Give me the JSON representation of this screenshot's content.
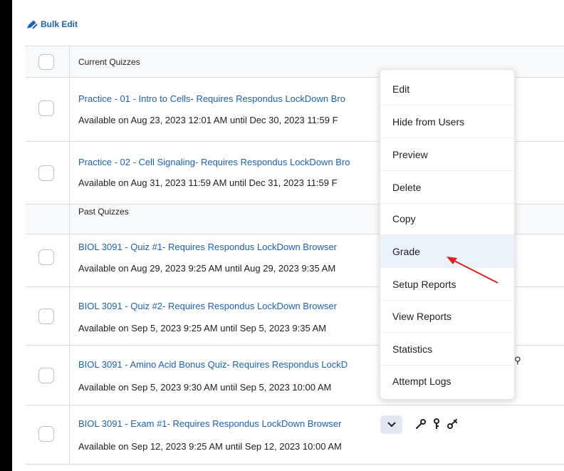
{
  "toolbar": {
    "bulk_edit_label": "Bulk Edit"
  },
  "sections": {
    "current": "Current Quizzes",
    "past": "Past Quizzes"
  },
  "quizzes": [
    {
      "title": "Practice - 01 - Intro to Cells- Requires Respondus LockDown Bro",
      "availability": "Available on Aug 23, 2023 12:01 AM until Dec 30, 2023 11:59 F"
    },
    {
      "title": "Practice - 02 - Cell Signaling- Requires Respondus LockDown Bro",
      "availability": "Available on Aug 31, 2023 11:59 AM until Dec 31, 2023 11:59 F"
    },
    {
      "title": "BIOL 3091 - Quiz #1- Requires Respondus LockDown Browser",
      "availability": "Available on Aug 29, 2023 9:25 AM until Aug 29, 2023 9:35 AM"
    },
    {
      "title": "BIOL 3091 - Quiz #2- Requires Respondus LockDown Browser",
      "availability": "Available on Sep 5, 2023 9:25 AM until Sep 5, 2023 9:35 AM"
    },
    {
      "title": "BIOL 3091 - Amino Acid Bonus Quiz- Requires Respondus LockD",
      "availability": "Available on Sep 5, 2023 9:30 AM until Sep 5, 2023 10:00 AM"
    },
    {
      "title": "BIOL 3091 - Exam #1- Requires Respondus LockDown Browser",
      "availability": "Available on Sep 12, 2023 9:25 AM until Sep 12, 2023 10:00 AM"
    }
  ],
  "context_menu": {
    "items": [
      "Edit",
      "Hide from Users",
      "Preview",
      "Delete",
      "Copy",
      "Grade",
      "Setup Reports",
      "View Reports",
      "Statistics",
      "Attempt Logs"
    ],
    "highlighted": "Grade"
  },
  "annotation": {
    "arrow_color": "#e02020"
  },
  "colors": {
    "link": "#1a63b3",
    "menu_highlight": "#eaf3fb"
  },
  "icons": [
    "bulk-edit-pencil-icon",
    "chevron-down-icon",
    "wrench-icon",
    "key-icon",
    "special-access-icon"
  ]
}
